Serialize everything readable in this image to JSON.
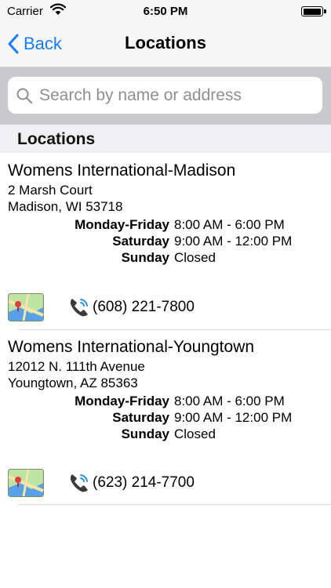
{
  "status_bar": {
    "carrier": "Carrier",
    "time": "6:50 PM",
    "battery_level": 1.0
  },
  "nav_bar": {
    "back_label": "Back",
    "title": "Locations"
  },
  "search": {
    "placeholder": "Search by name or address"
  },
  "section_header": "Locations",
  "locations": [
    {
      "name": "Womens International-Madison",
      "address_line1": "2 Marsh Court",
      "address_line2": "Madison, WI 53718",
      "hours": [
        {
          "day": "Monday-Friday",
          "time": "8:00 AM - 6:00 PM"
        },
        {
          "day": "Saturday",
          "time": "9:00 AM - 12:00 PM"
        },
        {
          "day": "Sunday",
          "time": "Closed"
        }
      ],
      "phone": "(608) 221-7800"
    },
    {
      "name": "Womens International-Youngtown",
      "address_line1": "12012 N. 111th Avenue",
      "address_line2": "Youngtown, AZ 85363",
      "hours": [
        {
          "day": "Monday-Friday",
          "time": "8:00 AM - 6:00 PM"
        },
        {
          "day": "Saturday",
          "time": "9:00 AM - 12:00 PM"
        },
        {
          "day": "Sunday",
          "time": "Closed"
        }
      ],
      "phone": "(623) 214-7700"
    }
  ],
  "colors": {
    "accent": "#1a7cf5",
    "search_bar_background": "#c9c9ce",
    "section_header_background": "#f0f0f2"
  }
}
